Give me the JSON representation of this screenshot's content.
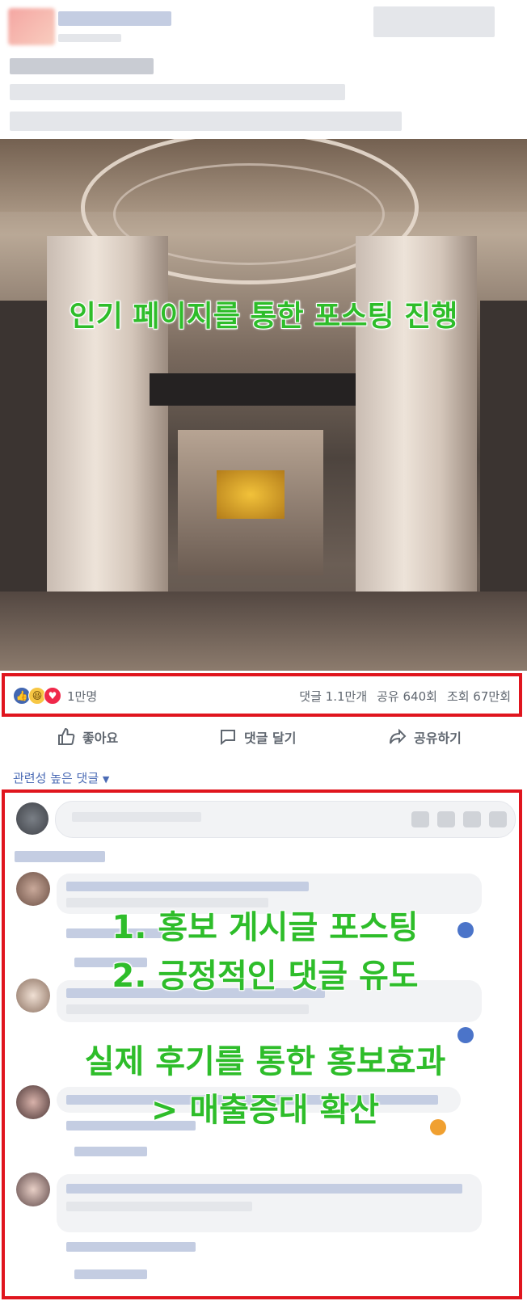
{
  "post": {
    "image_overlay_title": "인기 페이지를 통한 포스팅 진행"
  },
  "stats": {
    "reaction_count": "1만명",
    "comments": "댓글 1.1만개",
    "shares": "공유 640회",
    "views": "조회 67만회",
    "reaction_icons": [
      "like-icon",
      "haha-icon",
      "love-icon"
    ]
  },
  "actions": {
    "like": "좋아요",
    "comment": "댓글 달기",
    "share": "공유하기"
  },
  "sort_label": "관련성 높은 댓글",
  "comments_overlay": {
    "line1": "1. 홍보 게시글 포스팅",
    "line2": "2. 긍정적인 댓글 유도",
    "line3": "실제 후기를 통한 홍보효과",
    "line4": "> 매출증대 확산"
  },
  "colors": {
    "highlight_border": "#e0151e",
    "overlay_text": "#2ebd2a",
    "link_blue": "#4b6bb5"
  }
}
